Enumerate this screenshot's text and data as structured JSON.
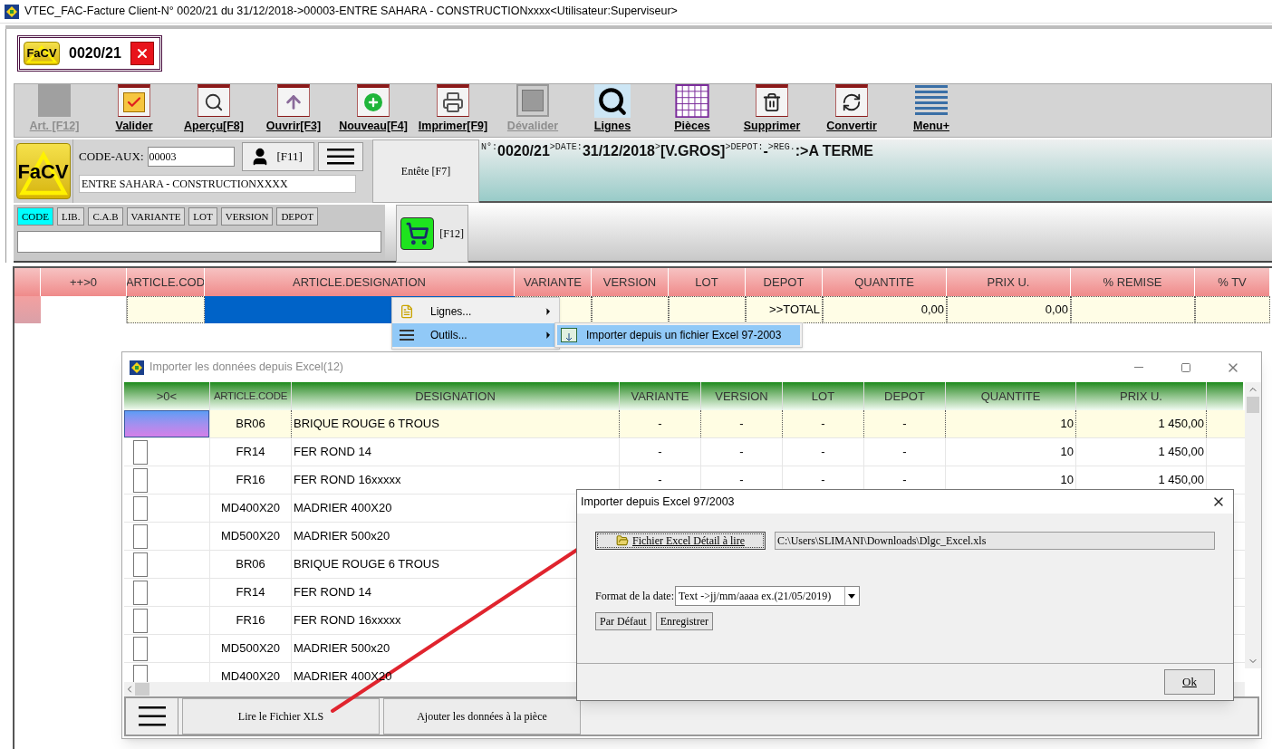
{
  "window": {
    "title": "VTEC_FAC-Facture Client-N° 0020/21 du 31/12/2018->00003-ENTRE SAHARA - CONSTRUCTIONxxxx<Utilisateur:Superviseur>"
  },
  "doc_tab": {
    "logo": "FaCV",
    "number": "0020/21"
  },
  "toolbar": [
    {
      "label": "Art. [F12]",
      "kind": "blank",
      "disabled": true
    },
    {
      "label": "Valider",
      "kind": "check",
      "disabled": false
    },
    {
      "label": "Aperçu[F8]",
      "kind": "preview",
      "disabled": false
    },
    {
      "label": "Ouvrir[F3]",
      "kind": "open",
      "disabled": false
    },
    {
      "label": "Nouveau[F4]",
      "kind": "new",
      "disabled": false
    },
    {
      "label": "Imprimer[F9]",
      "kind": "print",
      "disabled": false
    },
    {
      "label": "Dévalider",
      "kind": "square",
      "disabled": true
    },
    {
      "label": "Lignes",
      "kind": "search",
      "disabled": false
    },
    {
      "label": "Pièces",
      "kind": "grid",
      "disabled": false
    },
    {
      "label": "Supprimer",
      "kind": "trash",
      "disabled": false
    },
    {
      "label": "Convertir",
      "kind": "convert",
      "disabled": false
    },
    {
      "label": "Menu+",
      "kind": "menu",
      "disabled": false
    }
  ],
  "header": {
    "logo": "FaCV",
    "code_aux_label": "CODE-AUX:",
    "code_aux": "00003",
    "client_key": "[F11]",
    "client_name": "ENTRE SAHARA - CONSTRUCTIONXXXX",
    "entete": "Entête [F7]",
    "info": [
      {
        "kind": "label",
        "text": "N°:"
      },
      {
        "kind": "value",
        "text": "0020/21"
      },
      {
        "kind": "label",
        "text": ">DATE:"
      },
      {
        "kind": "value",
        "text": "31/12/2018"
      },
      {
        "kind": "label",
        "text": ">"
      },
      {
        "kind": "value",
        "text": "[V.GROS]"
      },
      {
        "kind": "label",
        "text": ">DEPOT:"
      },
      {
        "kind": "value",
        "text": "-"
      },
      {
        "kind": "label",
        "text": ">REG."
      },
      {
        "kind": "value",
        "text": ":>A TERME"
      }
    ]
  },
  "search": {
    "tabs": [
      {
        "label": "CODE",
        "selected": true
      },
      {
        "label": "LIB.",
        "selected": false
      },
      {
        "label": "C.A.B",
        "selected": false
      },
      {
        "label": "VARIANTE",
        "selected": false
      },
      {
        "label": "LOT",
        "selected": false
      },
      {
        "label": "VERSION",
        "selected": false
      },
      {
        "label": "DEPOT",
        "selected": false
      }
    ],
    "cart_key": "[F12]"
  },
  "grid": {
    "columns": [
      {},
      {
        "label": "++>0"
      },
      {
        "label": "ARTICLE.COD"
      },
      {
        "label": "ARTICLE.DESIGNATION"
      },
      {
        "label": "VARIANTE"
      },
      {
        "label": "VERSION"
      },
      {
        "label": "LOT"
      },
      {
        "label": "DEPOT"
      },
      {
        "label": "QUANTITE"
      },
      {
        "label": "PRIX U."
      },
      {
        "label": "% REMISE"
      },
      {
        "label": "% TV"
      }
    ],
    "row": [
      {
        "selected": false
      },
      {
        "selected": false
      },
      {
        "selected": false
      },
      {
        "selected": true
      },
      {
        "selected": false
      },
      {
        "selected": false
      },
      {
        "selected": false
      },
      {
        "text": ">>TOTAL",
        "selected": false
      },
      {
        "text": "0,00",
        "selected": false
      },
      {
        "text": "0,00",
        "selected": false
      },
      {
        "selected": false
      },
      {
        "selected": false
      }
    ]
  },
  "context_menu": {
    "items": [
      {
        "label": "Lignes...",
        "kind": "lines",
        "selected": false
      },
      {
        "label": "Outils...",
        "kind": "tools",
        "selected": true
      }
    ],
    "submenu": [
      {
        "label": "Importer depuis un fichier Excel 97-2003",
        "selected": true
      }
    ]
  },
  "import_window": {
    "title": "Importer les données depuis Excel(12)",
    "columns": [
      ">0<",
      "ARTICLE.CODE",
      "DESIGNATION",
      "VARIANTE",
      "VERSION",
      "LOT",
      "DEPOT",
      "QUANTITE",
      "PRIX U."
    ],
    "rows": [
      {
        "selected": true,
        "code": "BR06",
        "designation": "BRIQUE ROUGE 6 TROUS",
        "variante": "-",
        "version": "-",
        "lot": "-",
        "depot": "-",
        "quantite": "10",
        "prix": "1 450,00"
      },
      {
        "selected": false,
        "code": "FR14",
        "designation": "FER ROND 14",
        "variante": "-",
        "version": "-",
        "lot": "-",
        "depot": "-",
        "quantite": "10",
        "prix": "1 450,00"
      },
      {
        "selected": false,
        "code": "FR16",
        "designation": "FER ROND 16xxxxx",
        "variante": "-",
        "version": "-",
        "lot": "-",
        "depot": "-",
        "quantite": "10",
        "prix": "1 450,00"
      },
      {
        "selected": false,
        "code": "MD400X20",
        "designation": "MADRIER 400X20"
      },
      {
        "selected": false,
        "code": "MD500X20",
        "designation": "MADRIER 500x20"
      },
      {
        "selected": false,
        "code": "BR06",
        "designation": "BRIQUE ROUGE 6 TROUS"
      },
      {
        "selected": false,
        "code": "FR14",
        "designation": "FER ROND 14"
      },
      {
        "selected": false,
        "code": "FR16",
        "designation": "FER ROND 16xxxxx"
      },
      {
        "selected": false,
        "code": "MD500X20",
        "designation": "MADRIER 500x20"
      },
      {
        "selected": false,
        "code": "MD400X20",
        "designation": "MADRIER 400X20"
      }
    ],
    "buttons": [
      "Lire le Fichier XLS",
      "Ajouter les données à la pièce"
    ]
  },
  "dialog": {
    "title": "Importer depuis Excel 97/2003",
    "file_button": "Fichier Excel Détail à lire",
    "path": "C:\\Users\\SLIMANI\\Downloads\\Dlgc_Excel.xls",
    "date_label": "Format de la date:",
    "date_value": "Text ->jj/mm/aaaa ex.(21/05/2019)",
    "buttons": [
      "Par Défaut",
      "Enregistrer"
    ],
    "ok": "Ok"
  }
}
